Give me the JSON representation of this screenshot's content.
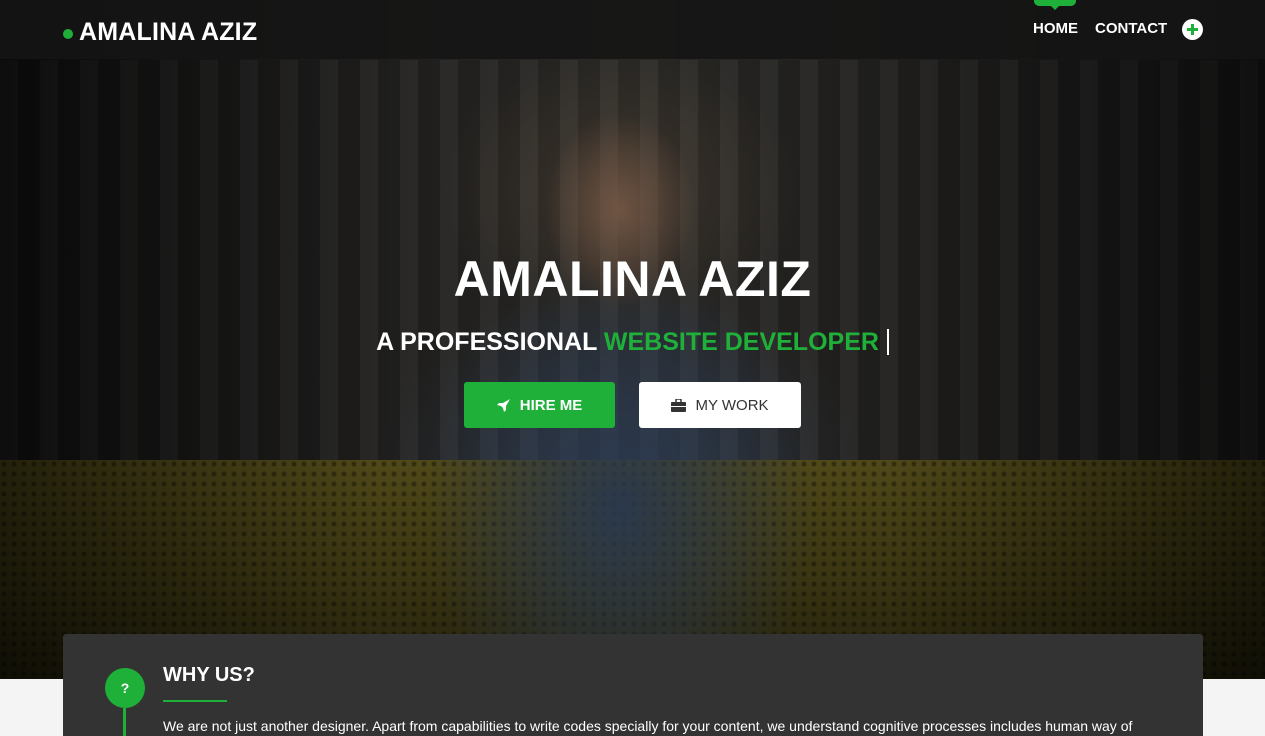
{
  "navbar": {
    "brand": "AMALINA AZIZ",
    "links": [
      {
        "label": "HOME",
        "active": true
      },
      {
        "label": "CONTACT",
        "active": false
      }
    ],
    "plus_icon": "plus-circle-icon"
  },
  "hero": {
    "title": "AMALINA AZIZ",
    "subtitle_prefix": "A PROFESSIONAL",
    "subtitle_accent": "WEBSITE DEVELOPER",
    "buttons": {
      "hire": {
        "label": "HIRE ME",
        "icon": "rocket-icon"
      },
      "work": {
        "label": "MY WORK",
        "icon": "briefcase-icon"
      }
    }
  },
  "why_us": {
    "icon_text": "?",
    "title": "WHY US?",
    "text": "We are not just another designer. Apart from capabilities to write codes specially for your content, we understand cognitive processes includes human way of"
  },
  "colors": {
    "accent": "#1fb03a",
    "navbar_bg": "#141414",
    "card_bg": "#333333"
  }
}
